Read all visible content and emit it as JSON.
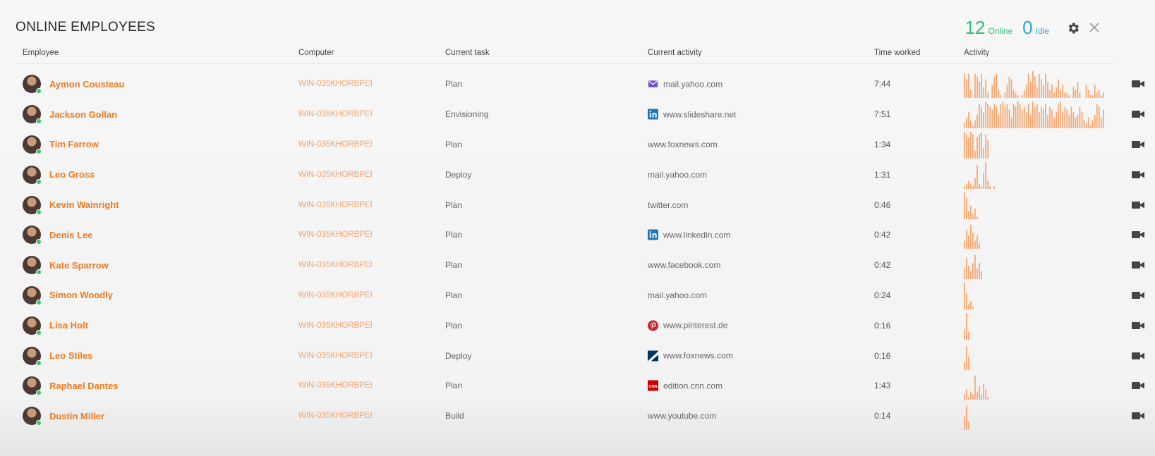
{
  "header": {
    "title": "ONLINE EMPLOYEES",
    "online_count": "12",
    "online_label": "Online",
    "idle_count": "0",
    "idle_label": "Idle"
  },
  "columns": {
    "employee": "Employee",
    "computer": "Computer",
    "task": "Current task",
    "activity": "Current activity",
    "time": "Time worked",
    "activity_chart": "Activity"
  },
  "colors": {
    "name": "#f07a1e",
    "computer": "#f7a36c",
    "online_dot": "#3cc56b",
    "online": "#33c07a",
    "idle": "#2ea3e0",
    "chart_bar": "#f7a36c"
  },
  "rows": [
    {
      "name": "Aymon Cousteau",
      "computer": "WIN-035KHORBPEI",
      "task": "Plan",
      "activity": "mail.yahoo.com",
      "icon": "yahoo-mail-icon",
      "time": "7:44",
      "chart": [
        0.9,
        0.7,
        0.9,
        0.3,
        0,
        0.9,
        0.8,
        0.6,
        0.9,
        0.4,
        0.7,
        0.2,
        0,
        0.5,
        0.8,
        0.9,
        0.3,
        0.1,
        0,
        0.2,
        0.5,
        0.8,
        0.7,
        0.3,
        0.2,
        0.1,
        0,
        0.1,
        0.3,
        0.5,
        0.9,
        0.6,
        1,
        0.8,
        0.4,
        0.9,
        0.7,
        0.5,
        0.9,
        0.6,
        0.3,
        0.5,
        0.2,
        0.4,
        0.7,
        0.3,
        0.5,
        0.2,
        0.2,
        0.1,
        0,
        0.4,
        0.3,
        0.6,
        0.2,
        0,
        0,
        0.5,
        0.3,
        0.1,
        0.1,
        0.5,
        0.2,
        0.3,
        0.1,
        0.2
      ]
    },
    {
      "name": "Jackson Gollan",
      "computer": "WIN-035KHORBPEI",
      "task": "Envisioning",
      "activity": "www.slideshare.net",
      "icon": "linkedin-icon",
      "time": "7:51",
      "chart": [
        0.2,
        0.4,
        0.6,
        0.3,
        0.1,
        0.3,
        0.5,
        0.9,
        0.8,
        0.6,
        1,
        0.9,
        0.8,
        0.7,
        0.9,
        0.8,
        0.5,
        0.9,
        1,
        0.8,
        0.9,
        0.7,
        0.4,
        0.9,
        0.8,
        1,
        0.9,
        0.7,
        0.8,
        0.6,
        0.9,
        0.5,
        1,
        0.8,
        0.9,
        0.6,
        0.8,
        0.7,
        0.9,
        0.5,
        0.8,
        0.7,
        0.4,
        0.6,
        0.9,
        1,
        0.6,
        0.8,
        0.7,
        0.5,
        0.8,
        0.6,
        0.4,
        0.5,
        0.8,
        0.6,
        0.3,
        0.2,
        0.4,
        0.1,
        0.3,
        0.5,
        0.9,
        0.8,
        0.4,
        0.7
      ]
    },
    {
      "name": "Tim Farrow",
      "computer": "WIN-035KHORBPEI",
      "task": "Plan",
      "activity": "www.foxnews.com",
      "icon": "",
      "time": "1:34",
      "chart": [
        1,
        0.9,
        0.8,
        1,
        0.9,
        0.3,
        0.8,
        0.9,
        1,
        0.4,
        0.9,
        0.7
      ]
    },
    {
      "name": "Leo Gross",
      "computer": "WIN-035KHORBPEI",
      "task": "Deploy",
      "activity": "mail.yahoo.com",
      "icon": "",
      "time": "1:31",
      "chart": [
        0.1,
        0.2,
        0.3,
        0.2,
        0.1,
        0.4,
        0.9,
        0.2,
        0.1,
        0.6,
        1,
        0.3,
        0.1,
        0,
        0.1
      ]
    },
    {
      "name": "Kevin Wainright",
      "computer": "WIN-035KHORBPEI",
      "task": "Plan",
      "activity": "twitter.com",
      "icon": "",
      "time": "0:46",
      "chart": [
        1,
        0.8,
        0.3,
        0.5,
        0.2,
        0.4,
        0.1
      ]
    },
    {
      "name": "Denis Lee",
      "computer": "WIN-035KHORBPEI",
      "task": "Plan",
      "activity": "www.linkedin.com",
      "icon": "linkedin-icon",
      "time": "0:42",
      "chart": [
        0.3,
        0.7,
        0.5,
        0.9,
        0.6,
        0.3,
        0.5,
        0.2
      ]
    },
    {
      "name": "Kate Sparrow",
      "computer": "WIN-035KHORBPEI",
      "task": "Plan",
      "activity": "www.facebook.com",
      "icon": "",
      "time": "0:42",
      "chart": [
        0.4,
        0.8,
        0.5,
        0.3,
        0.6,
        0.9,
        0.4,
        0.6,
        0.3
      ]
    },
    {
      "name": "Simon Woodly",
      "computer": "WIN-035KHORBPEI",
      "task": "Plan",
      "activity": "mail.yahoo.com",
      "icon": "",
      "time": "0:24",
      "chart": [
        1,
        0.6,
        0.2,
        0.3,
        0.1
      ]
    },
    {
      "name": "Lisa Holt",
      "computer": "WIN-035KHORBPEI",
      "task": "Plan",
      "activity": "www.pinterest.de",
      "icon": "pinterest-icon",
      "time": "0:16",
      "chart": [
        0.4,
        1,
        0.3
      ]
    },
    {
      "name": "Leo Stiles",
      "computer": "WIN-035KHORBPEI",
      "task": "Deploy",
      "activity": "www.foxnews.com",
      "icon": "foxnews-icon",
      "time": "0:16",
      "chart": [
        0.3,
        0.9,
        0.5
      ]
    },
    {
      "name": "Raphael Dantes",
      "computer": "WIN-035KHORBPEI",
      "task": "Plan",
      "activity": "edition.cnn.com",
      "icon": "cnn-icon",
      "time": "1:43",
      "chart": [
        0.2,
        0.4,
        0.1,
        0.3,
        0.2,
        0.9,
        0.3,
        0.5,
        0.2,
        0.6,
        0.4,
        0.1
      ]
    },
    {
      "name": "Dustin Miller",
      "computer": "WIN-035KHORBPEI",
      "task": "Build",
      "activity": "www.youtube.com",
      "icon": "",
      "time": "0:14",
      "chart": [
        0.5,
        0.9,
        0.3
      ]
    }
  ]
}
